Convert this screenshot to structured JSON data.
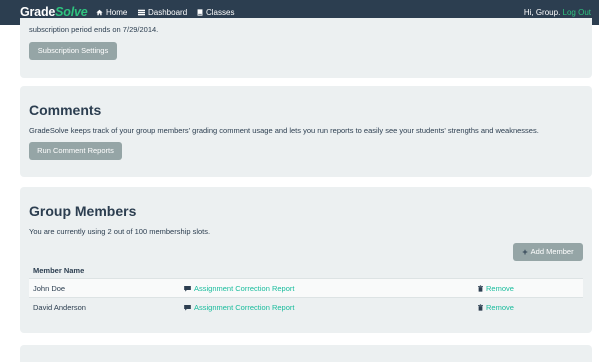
{
  "navbar": {
    "brand_part1": "Grade",
    "brand_part2": "Solve",
    "links": [
      {
        "label": "Home",
        "icon": "home-icon"
      },
      {
        "label": "Dashboard",
        "icon": "list-icon"
      },
      {
        "label": "Classes",
        "icon": "book-icon"
      }
    ],
    "greeting": "Hi, Group.",
    "logout_label": "Log Out"
  },
  "subscription": {
    "text": "subscription period ends on 7/29/2014.",
    "button_label": "Subscription Settings"
  },
  "comments": {
    "title": "Comments",
    "description": "GradeSolve keeps track of your group members' grading comment usage and lets you run reports to easily see your students' strengths and weaknesses.",
    "button_label": "Run Comment Reports"
  },
  "members": {
    "title": "Group Members",
    "description": "You are currently using 2 out of 100 membership slots.",
    "add_button_label": "Add Member",
    "column_header": "Member Name",
    "rows": [
      {
        "name": "John Doe",
        "report_label": "Assignment Correction Report",
        "remove_label": "Remove"
      },
      {
        "name": "David Anderson",
        "report_label": "Assignment Correction Report",
        "remove_label": "Remove"
      }
    ]
  },
  "colors": {
    "navbar": "#2c3e50",
    "accent": "#18bc9c",
    "panel": "#ecf0f1",
    "button": "#95a5a6"
  }
}
